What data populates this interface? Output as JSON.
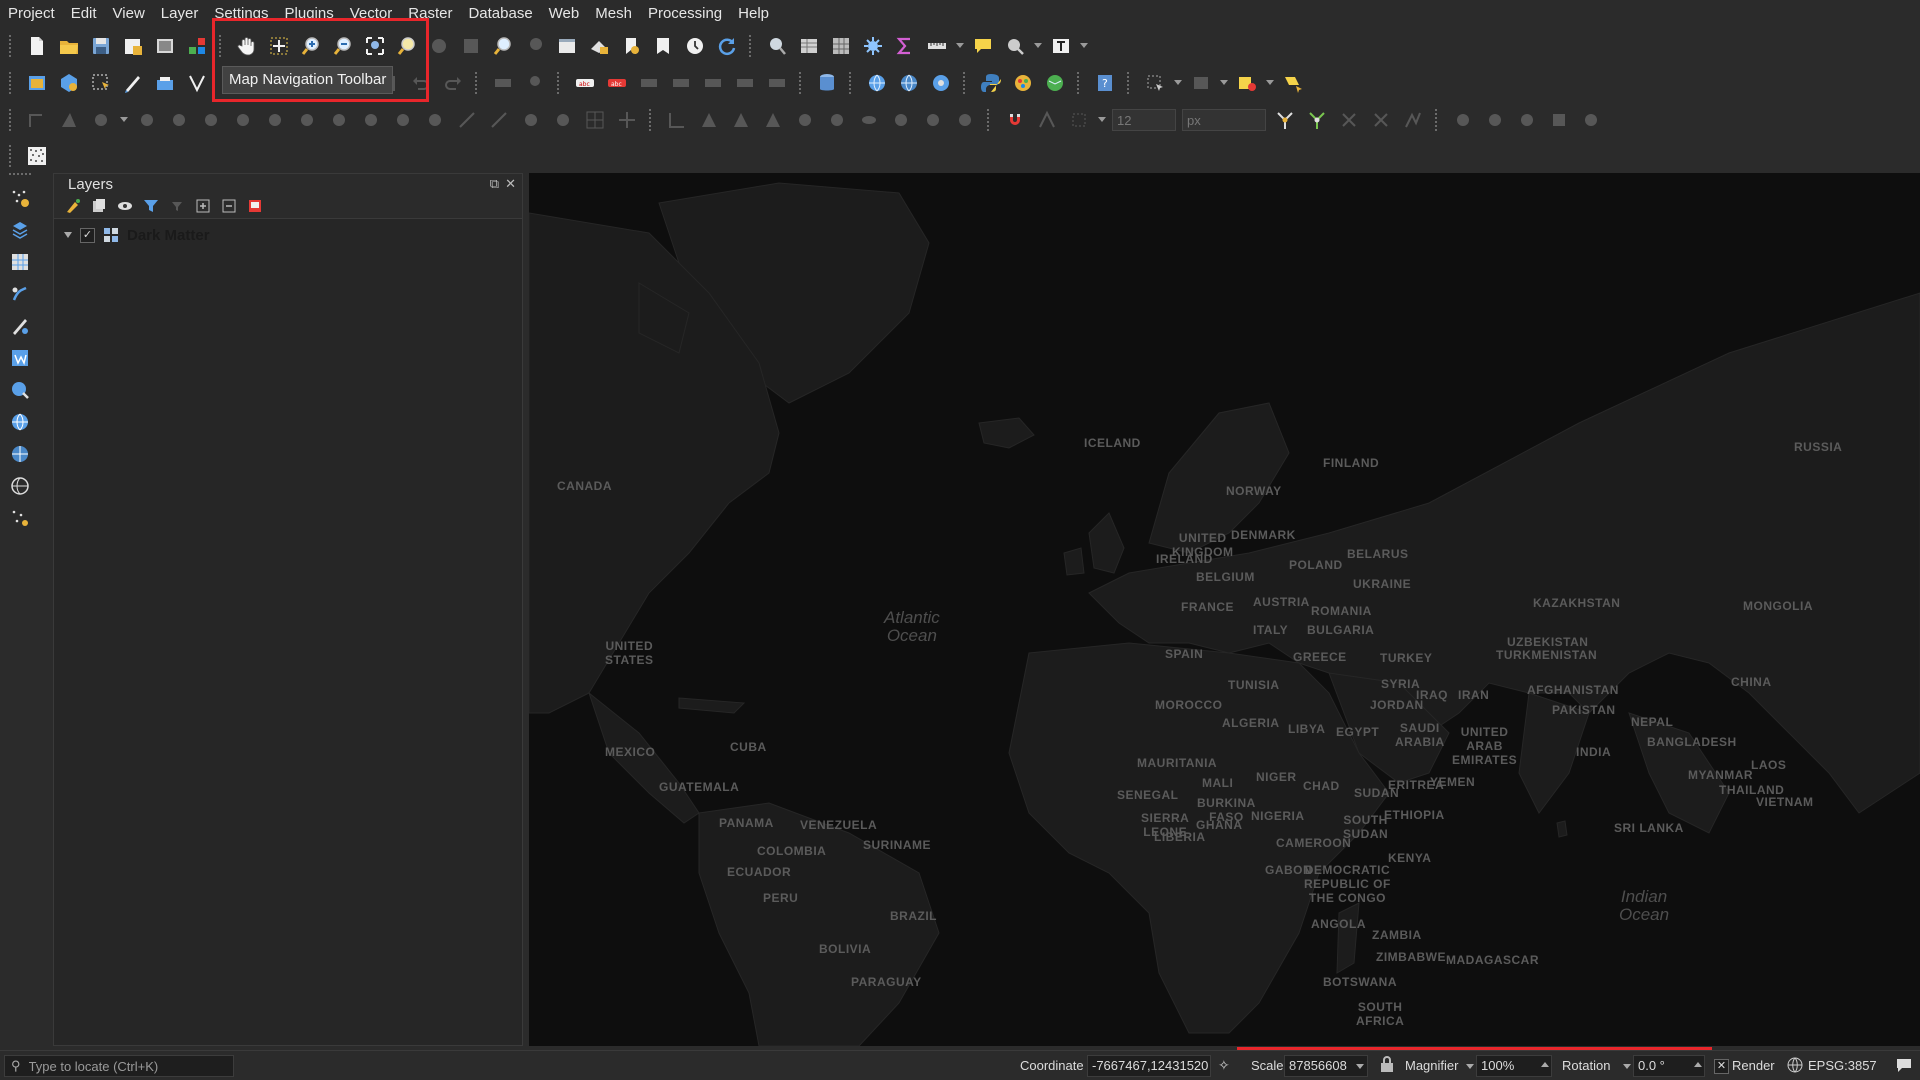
{
  "menubar": {
    "items": [
      "Project",
      "Edit",
      "View",
      "Layer",
      "Settings",
      "Plugins",
      "Vector",
      "Raster",
      "Database",
      "Web",
      "Mesh",
      "Processing",
      "Help"
    ]
  },
  "tooltip": {
    "text": "Map Navigation Toolbar"
  },
  "snapping": {
    "tolerance": "12",
    "units": "px"
  },
  "layers_panel": {
    "title": "Layers",
    "layer": {
      "name": "Dark Matter",
      "checked": true
    }
  },
  "map": {
    "ocean_labels": {
      "atlantic": "Atlantic\nOcean",
      "indian": "Indian\nOcean"
    },
    "country_labels": {
      "iceland": "ICELAND",
      "russia": "RUSSIA",
      "canada": "CANADA",
      "finland": "FINLAND",
      "norway": "NORWAY",
      "united_kingdom": "UNITED\nKINGDOM",
      "ireland": "IRELAND",
      "denmark": "DENMARK",
      "poland": "POLAND",
      "belarus": "BELARUS",
      "belgium": "BELGIUM",
      "ukraine": "UKRAINE",
      "kazakhstan": "KAZAKHSTAN",
      "france": "FRANCE",
      "austria": "AUSTRIA",
      "romania": "ROMANIA",
      "mongolia": "MONGOLIA",
      "italy": "ITALY",
      "bulgaria": "BULGARIA",
      "uzbekistan": "UZBEKISTAN",
      "united_states": "UNITED\nSTATES",
      "spain": "SPAIN",
      "turkey": "TURKEY",
      "turkmenistan": "TURKMENISTAN",
      "greece": "GREECE",
      "tunisia": "TUNISIA",
      "syria": "SYRIA",
      "iraq": "IRAQ",
      "iran": "IRAN",
      "afghanistan": "AFGHANISTAN",
      "china": "CHINA",
      "morocco": "MOROCCO",
      "jordan": "JORDAN",
      "pakistan": "PAKISTAN",
      "algeria": "ALGERIA",
      "libya": "LIBYA",
      "egypt": "EGYPT",
      "saudi_arabia": "SAUDI\nARABIA",
      "nepal": "NEPAL",
      "mexico": "MEXICO",
      "cuba": "CUBA",
      "uae": "UNITED\nARAB\nEMIRATES",
      "india": "INDIA",
      "bangladesh": "BANGLADESH",
      "mauritania": "MAURITANIA",
      "guatemala": "GUATEMALA",
      "mali": "MALI",
      "niger": "NIGER",
      "chad": "CHAD",
      "sudan": "SUDAN",
      "eritrea": "ERITREA",
      "yemen": "YEMEN",
      "myanmar": "MYANMAR",
      "laos": "LAOS",
      "thailand": "THAILAND",
      "vietnam": "VIETNAM",
      "senegal": "SENEGAL",
      "burkina_faso": "BURKINA\nFASO",
      "sierra_leone": "SIERRA\nLEONE",
      "liberia": "LIBERIA",
      "ghana": "GHANA",
      "nigeria": "NIGERIA",
      "ethiopia": "ETHIOPIA",
      "south_sudan": "SOUTH\nSUDAN",
      "panama": "PANAMA",
      "venezuela": "VENEZUELA",
      "suriname": "SURINAME",
      "sri_lanka": "SRI LANKA",
      "colombia": "COLOMBIA",
      "cameroon": "CAMEROON",
      "ecuador": "ECUADOR",
      "gabon": "GABON",
      "drc": "DEMOCRATIC\nREPUBLIC OF\nTHE CONGO",
      "kenya": "KENYA",
      "peru": "PERU",
      "brazil": "BRAZIL",
      "angola": "ANGOLA",
      "bolivia": "BOLIVIA",
      "zambia": "ZAMBIA",
      "zimbabwe": "ZIMBABWE",
      "madagascar": "MADAGASCAR",
      "paraguay": "PARAGUAY",
      "botswana": "BOTSWANA",
      "south_africa": "SOUTH\nAFRICA"
    }
  },
  "statusbar": {
    "locator_placeholder": "Type to locate (Ctrl+K)",
    "coordinate_label": "Coordinate",
    "coordinate_value": "-7667467,12431520",
    "scale_label": "Scale",
    "scale_value": "87856608",
    "magnifier_label": "Magnifier",
    "magnifier_value": "100%",
    "rotation_label": "Rotation",
    "rotation_value": "0.0 °",
    "render_label": "Render",
    "render_checked": true,
    "crs_label": "EPSG:3857"
  },
  "colors": {
    "highlight": "#e8262b",
    "background": "#2b2b2b",
    "map_land": "#1c1c1c",
    "map_water": "#0e0e0e"
  }
}
